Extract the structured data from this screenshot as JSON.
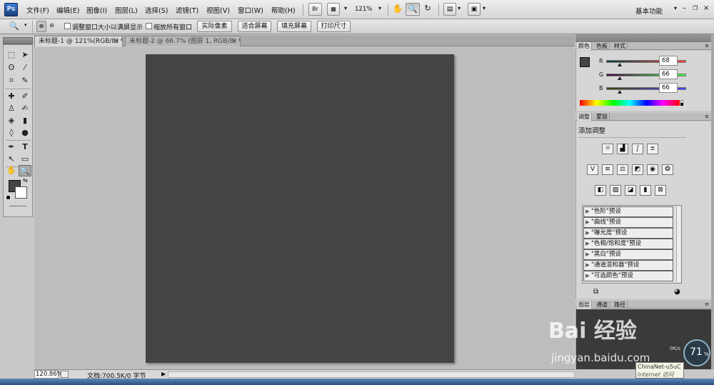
{
  "app": {
    "logo": "Ps"
  },
  "menu": [
    "文件(F)",
    "编辑(E)",
    "图像(I)",
    "图层(L)",
    "选择(S)",
    "滤镜(T)",
    "视图(V)",
    "窗口(W)",
    "帮助(H)"
  ],
  "menubar_tools": {
    "bridge": "Br",
    "zoom_level": "121%",
    "workspace": "基本功能"
  },
  "options_bar": {
    "resize_windows_label": "调整窗口大小以满屏显示",
    "zoom_all_label": "缩放所有窗口",
    "actual_pixels": "实际像素",
    "fit_screen": "适合屏幕",
    "fill_screen": "填充屏幕",
    "print_size": "打印尺寸"
  },
  "documents": [
    {
      "title": "未标题-1 @ 121%(RGB/8) *",
      "active": true
    },
    {
      "title": "未标题-2 @ 66.7% (图层 1, RGB/8) *",
      "active": false
    }
  ],
  "canvas": {
    "fill": "#444444"
  },
  "status": {
    "zoom": "120.86%",
    "doc_info": "文档:700.5K/0 字节"
  },
  "panels": {
    "color": {
      "tabs": [
        "颜色",
        "色板",
        "样式"
      ],
      "r": {
        "label": "R",
        "value": "68"
      },
      "g": {
        "label": "G",
        "value": "66"
      },
      "b": {
        "label": "B",
        "value": "66"
      }
    },
    "adjustments": {
      "tabs": [
        "调整",
        "蒙版"
      ],
      "title": "添加调整",
      "presets": [
        "\"色阶\"预设",
        "\"曲线\"预设",
        "\"曝光度\"预设",
        "\"色相/饱和度\"预设",
        "\"黑白\"预设",
        "\"通道混和器\"预设",
        "\"可选颜色\"预设"
      ]
    },
    "layers": {
      "tabs": [
        "图层",
        "通道",
        "路径"
      ]
    }
  },
  "overlay": {
    "watermark_text": "Bai 经验",
    "watermark_url": "jingyan.baidu.com",
    "network_badge": "71",
    "network_percent": "%",
    "speed": "0K/s",
    "tooltip_title": "ChinaNet-u5uC",
    "tooltip_sub": "Internet 访问"
  }
}
